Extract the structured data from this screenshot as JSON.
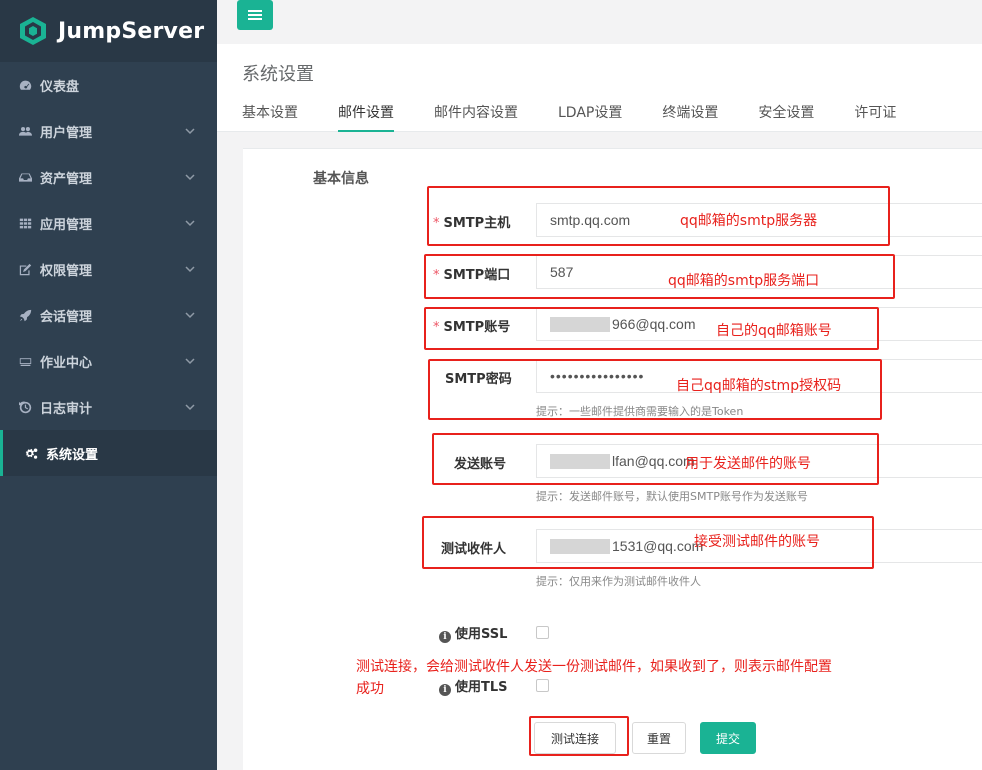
{
  "app": {
    "name": "JumpServer"
  },
  "sidebar": {
    "items": [
      {
        "label": "仪表盘",
        "icon": "dashboard-icon",
        "has_children": false
      },
      {
        "label": "用户管理",
        "icon": "users-icon",
        "has_children": true
      },
      {
        "label": "资产管理",
        "icon": "inbox-icon",
        "has_children": true
      },
      {
        "label": "应用管理",
        "icon": "grid-icon",
        "has_children": true
      },
      {
        "label": "权限管理",
        "icon": "edit-icon",
        "has_children": true
      },
      {
        "label": "会话管理",
        "icon": "rocket-icon",
        "has_children": true
      },
      {
        "label": "作业中心",
        "icon": "keyboard-icon",
        "has_children": true
      },
      {
        "label": "日志审计",
        "icon": "history-icon",
        "has_children": true
      },
      {
        "label": "系统设置",
        "icon": "gears-icon",
        "has_children": false,
        "active": true
      }
    ]
  },
  "header": {
    "title": "系统设置",
    "tabs": [
      "基本设置",
      "邮件设置",
      "邮件内容设置",
      "LDAP设置",
      "终端设置",
      "安全设置",
      "许可证"
    ],
    "active_tab": "邮件设置"
  },
  "form": {
    "section_title": "基本信息",
    "smtp_host": {
      "label": "SMTP主机",
      "value": "smtp.qq.com",
      "required": true
    },
    "smtp_port": {
      "label": "SMTP端口",
      "value": "587",
      "required": true
    },
    "smtp_user": {
      "label": "SMTP账号",
      "value_suffix": "966@qq.com",
      "required": true
    },
    "smtp_password": {
      "label": "SMTP密码",
      "value": "••••••••••••••••",
      "hint": "提示：一些邮件提供商需要输入的是Token"
    },
    "from_account": {
      "label": "发送账号",
      "value_suffix": "lfan@qq.com",
      "hint": "提示：发送邮件账号，默认使用SMTP账号作为发送账号"
    },
    "test_recipient": {
      "label": "测试收件人",
      "value_suffix": "1531@qq.com",
      "hint": "提示：仅用来作为测试邮件收件人"
    },
    "use_ssl": {
      "label": "使用SSL",
      "checked": false
    },
    "use_tls": {
      "label": "使用TLS",
      "checked": false
    }
  },
  "buttons": {
    "test": "测试连接",
    "reset": "重置",
    "submit": "提交"
  },
  "annotations": {
    "host": "qq邮箱的smtp服务器",
    "port": "qq邮箱的smtp服务端口",
    "user": "自己的qq邮箱账号",
    "password": "自己qq邮箱的stmp授权码",
    "from": "用于发送邮件的账号",
    "recipient": "接受测试邮件的账号",
    "test_line1": "测试连接，会给测试收件人发送一份测试邮件，如果收到了，则表示邮件配置",
    "test_line2": "成功"
  },
  "colors": {
    "accent": "#1ab394",
    "sidebar": "#2f4050",
    "annotation": "#e8211c"
  }
}
